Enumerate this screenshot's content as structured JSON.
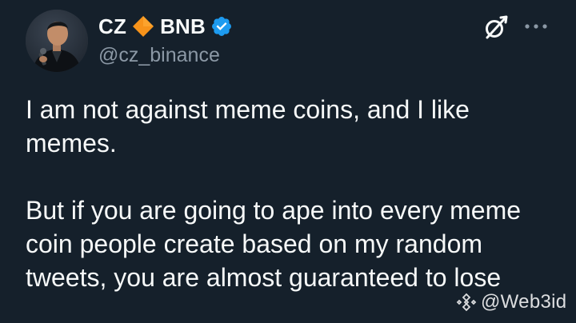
{
  "author": {
    "display_name_1": "CZ",
    "display_name_2": "BNB",
    "handle": "@cz_binance"
  },
  "tweet": {
    "paragraphs": [
      "I am not against meme coins, and I like memes.",
      "But if you are going to ape into every meme coin people create based on my random tweets, you are almost guaranteed to lose"
    ]
  },
  "watermark": {
    "text": "@Web3id"
  },
  "colors": {
    "background": "#15202b",
    "text": "#f7f9f9",
    "secondary_text": "#8b98a5",
    "verified_badge": "#1d9bf0",
    "diamond": "#f7931a"
  },
  "icons": {
    "avatar": "profile-photo",
    "diamond": "orange-diamond-icon",
    "verified": "verified-badge-icon",
    "grok": "grok-icon",
    "more": "more-options-icon",
    "watermark_logo": "binance-logo-icon"
  }
}
